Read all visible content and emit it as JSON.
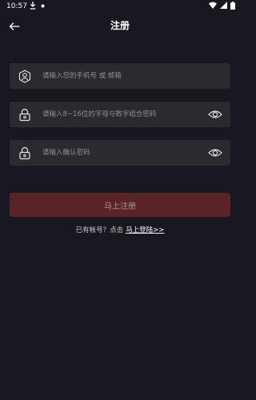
{
  "status_bar": {
    "time": "10:57"
  },
  "header": {
    "title": "注册"
  },
  "form": {
    "account_placeholder": "请输入您的手机号 或 邮箱",
    "password_placeholder": "请输入8~16位的字母与数字组合密码",
    "confirm_password_placeholder": "请输入确认密码"
  },
  "register_button": {
    "label": "马上注册"
  },
  "login_prompt": {
    "text": "已有帐号？点击",
    "link": "马上登陆>>"
  },
  "colors": {
    "background": "#181920",
    "field": "#2a2b2e",
    "button": "#5a2328",
    "placeholder": "#8e8f92"
  }
}
